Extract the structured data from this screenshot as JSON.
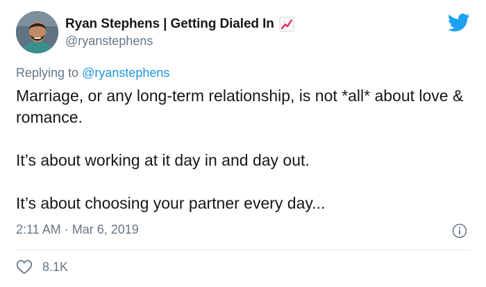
{
  "author": {
    "display_name": "Ryan Stephens | Getting Dialed In",
    "handle": "@ryanstephens",
    "name_emoji": "chart-increasing-icon"
  },
  "reply": {
    "prefix": "Replying to",
    "mention": "@ryanstephens"
  },
  "tweet": {
    "paragraphs": [
      "Marriage, or any long-term relationship, is not *all* about love & romance.",
      "It’s about working at it day in and day out.",
      "It’s about choosing your partner every day..."
    ]
  },
  "meta": {
    "timestamp": "2:11 AM · Mar 6, 2019"
  },
  "engagement": {
    "likes": "8.1K"
  },
  "colors": {
    "text_primary": "#14171a",
    "text_secondary": "#657786",
    "link": "#1b95e0",
    "twitter_blue": "#1da1f2",
    "divider": "#e1e8ed"
  },
  "icons": [
    "avatar",
    "chart-increasing-icon",
    "twitter-bird-icon",
    "info-icon",
    "heart-icon"
  ]
}
